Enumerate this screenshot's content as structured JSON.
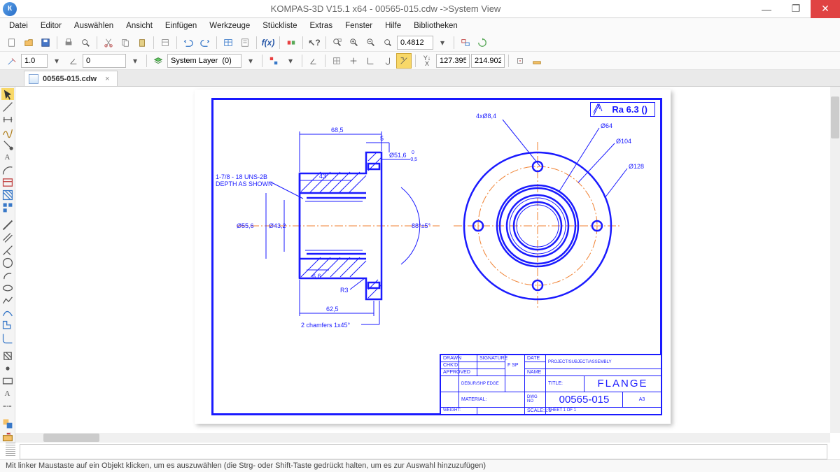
{
  "title": "KOMPAS-3D V15.1 x64 - 00565-015.cdw ->System View",
  "menu": [
    "Datei",
    "Editor",
    "Auswählen",
    "Ansicht",
    "Einfügen",
    "Werkzeuge",
    "Stückliste",
    "Extras",
    "Fenster",
    "Hilfe",
    "Bibliotheken"
  ],
  "toolbar1": {
    "zoom_value": "0.4812"
  },
  "toolbar2": {
    "step": "1.0",
    "angle": "0",
    "layer": "System Layer  (0)",
    "coord_x": "127.395",
    "coord_y": "214.902"
  },
  "tab": {
    "name": "00565-015.cdw"
  },
  "drawing": {
    "surface_finish": "Ra 6.3",
    "view1": {
      "dims": {
        "d1": "68,5",
        "d2": "5",
        "d3": "Ø51,6",
        "d3_tol_top": "0",
        "d3_tol_bot": "-0,5",
        "d4": "43",
        "d5": "Ø55,6",
        "d6": "Ø43,2",
        "thread": "1-7/8 - 18 UNS-2B",
        "thread_note": "DEPTH AS SHOWN",
        "d7": "6,6",
        "d8": "R3",
        "d9": "62,5",
        "d10": "2 chamfers 1x45°",
        "angle": "88°±5°"
      }
    },
    "view2": {
      "dims": {
        "bc": "4xØ8,4",
        "d1": "Ø64",
        "d2": "Ø104",
        "d3": "Ø128"
      }
    },
    "titleblock": {
      "title_label": "TITLE:",
      "title": "FLANGE",
      "drawing_no": "00565-015",
      "sheet": "A3",
      "material_label": "MATERIAL:",
      "project": "PROJECT/SUBJECT/ASSEMBLY",
      "scale_label": "SCALE:1:1",
      "approved": "APPROVED",
      "chkd": "CHK'D",
      "drawn": "DRAWN",
      "signature": "SIGNATURE",
      "date": "DATE",
      "name": "NAME"
    }
  },
  "status": "Mit linker Maustaste auf ein Objekt klicken, um es auszuwählen (die Strg- oder Shift-Taste gedrückt halten, um es zur Auswahl hinzuzufügen)"
}
